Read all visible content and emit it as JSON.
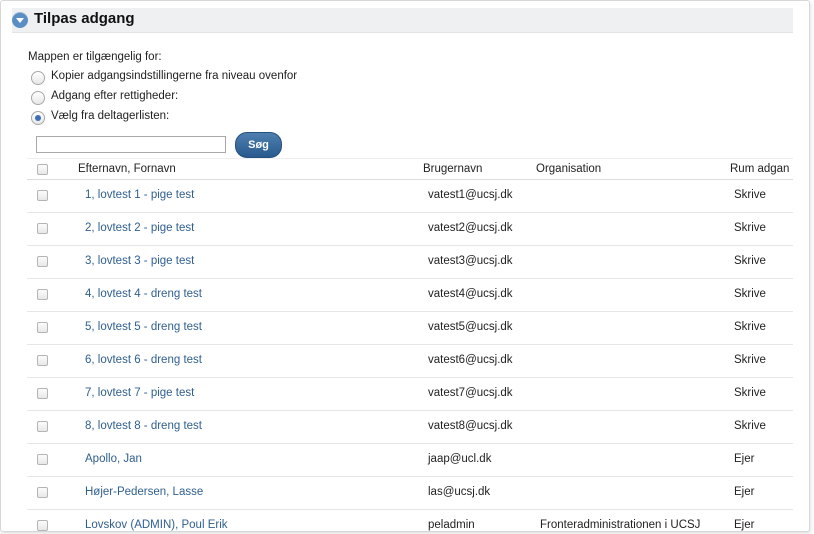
{
  "header": {
    "title": "Tilpas adgang"
  },
  "access": {
    "label": "Mappen er tilgængelig for:",
    "options": [
      {
        "label": "Kopier adgangsindstillingerne fra niveau ovenfor",
        "checked": false
      },
      {
        "label": "Adgang efter rettigheder:",
        "checked": false
      },
      {
        "label": "Vælg fra deltagerlisten:",
        "checked": true
      }
    ]
  },
  "search": {
    "value": "",
    "button": "Søg"
  },
  "table": {
    "headers": {
      "name": "Efternavn,  Fornavn",
      "username": "Brugernavn",
      "organisation": "Organisation",
      "access": "Rum adgan"
    },
    "rows": [
      {
        "name": "1, lovtest 1 - pige test",
        "username": "vatest1@ucsj.dk",
        "organisation": "",
        "access": "Skrive"
      },
      {
        "name": "2, lovtest 2 - pige test",
        "username": "vatest2@ucsj.dk",
        "organisation": "",
        "access": "Skrive"
      },
      {
        "name": "3, lovtest 3 - pige test",
        "username": "vatest3@ucsj.dk",
        "organisation": "",
        "access": "Skrive"
      },
      {
        "name": "4, lovtest 4 - dreng test",
        "username": "vatest4@ucsj.dk",
        "organisation": "",
        "access": "Skrive"
      },
      {
        "name": "5, lovtest 5 - dreng test",
        "username": "vatest5@ucsj.dk",
        "organisation": "",
        "access": "Skrive"
      },
      {
        "name": "6, lovtest 6 - dreng test",
        "username": "vatest6@ucsj.dk",
        "organisation": "",
        "access": "Skrive"
      },
      {
        "name": "7, lovtest 7 - pige test",
        "username": "vatest7@ucsj.dk",
        "organisation": "",
        "access": "Skrive"
      },
      {
        "name": "8, lovtest 8 - dreng test",
        "username": "vatest8@ucsj.dk",
        "organisation": "",
        "access": "Skrive"
      },
      {
        "name": "Apollo, Jan",
        "username": "jaap@ucl.dk",
        "organisation": "",
        "access": "Ejer"
      },
      {
        "name": "Højer-Pedersen, Lasse",
        "username": "las@ucsj.dk",
        "organisation": "",
        "access": "Ejer"
      },
      {
        "name": "Lovskov (ADMIN), Poul Erik",
        "username": "peladmin",
        "organisation": "Fronteradministrationen i UCSJ",
        "access": "Ejer"
      }
    ]
  },
  "colors": {
    "link": "#2f5f8f",
    "button": "#285a8e",
    "radio_selected": "#3d6fb6",
    "toggle": "#5b8ec2"
  }
}
